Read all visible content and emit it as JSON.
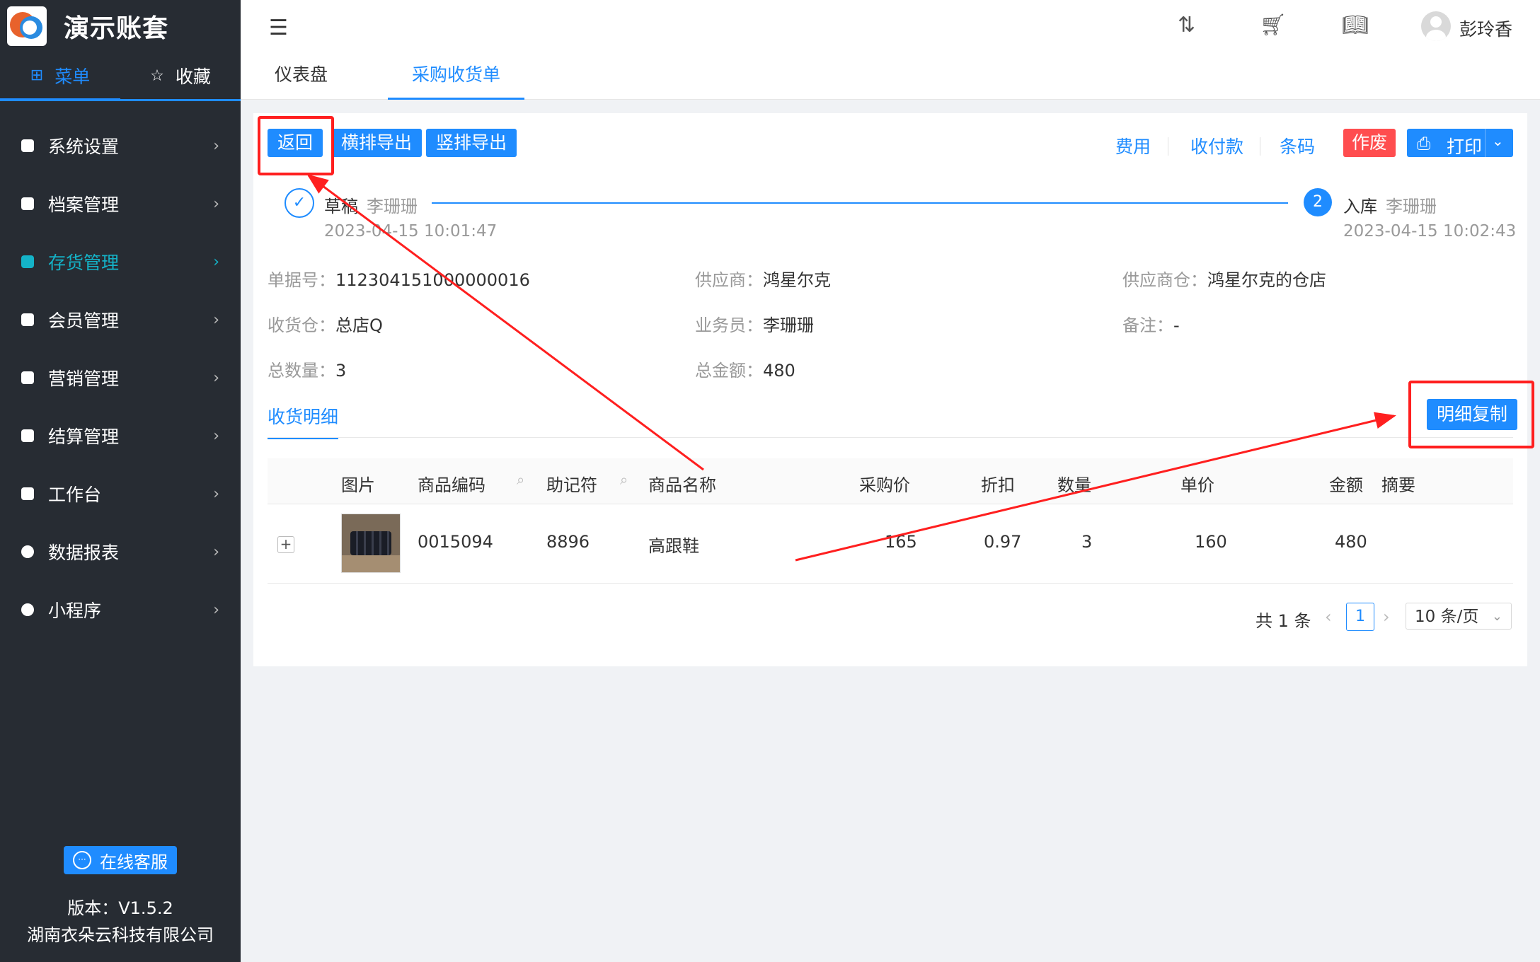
{
  "brand": {
    "title": "演示账套"
  },
  "sidebar": {
    "tabs": [
      {
        "label": "菜单",
        "icon": "grid-icon"
      },
      {
        "label": "收藏",
        "icon": "star-icon"
      }
    ],
    "items": [
      {
        "label": "系统设置"
      },
      {
        "label": "档案管理"
      },
      {
        "label": "存货管理"
      },
      {
        "label": "会员管理"
      },
      {
        "label": "营销管理"
      },
      {
        "label": "结算管理"
      },
      {
        "label": "工作台"
      },
      {
        "label": "数据报表"
      },
      {
        "label": "小程序"
      }
    ],
    "active": "存货管理",
    "online_service": "在线客服",
    "version": "版本：V1.5.2",
    "company": "湖南衣朵云科技有限公司"
  },
  "header": {
    "username": "彭玲香"
  },
  "page_tabs": [
    {
      "label": "仪表盘"
    },
    {
      "label": "采购收货单"
    }
  ],
  "toolbar": {
    "back": "返回",
    "export_h": "横排导出",
    "export_v": "竖排导出",
    "fee": "费用",
    "payment": "收付款",
    "barcode": "条码",
    "void": "作废",
    "print": "打印"
  },
  "steps": [
    {
      "name": "草稿",
      "user": "李珊珊",
      "time": "2023-04-15 10:01:47"
    },
    {
      "num": "2",
      "name": "入库",
      "user": "李珊珊",
      "time": "2023-04-15 10:02:43"
    }
  ],
  "info": {
    "doc_no_k": "单据号：",
    "doc_no_v": "112304151000000016",
    "supplier_k": "供应商：",
    "supplier_v": "鸿星尔克",
    "supplier_wh_k": "供应商仓：",
    "supplier_wh_v": "鸿星尔克的仓店",
    "recv_wh_k": "收货仓：",
    "recv_wh_v": "总店Q",
    "salesman_k": "业务员：",
    "salesman_v": "李珊珊",
    "remark_k": "备注：",
    "remark_v": "-",
    "total_qty_k": "总数量：",
    "total_qty_v": "3",
    "total_amt_k": "总金额：",
    "total_amt_v": "480"
  },
  "detail": {
    "tab": "收货明细",
    "copy_btn": "明细复制",
    "columns": [
      "图片",
      "商品编码",
      "助记符",
      "商品名称",
      "采购价",
      "折扣",
      "数量",
      "单价",
      "金额",
      "摘要"
    ],
    "rows": [
      {
        "code": "0015094",
        "mnemonic": "8896",
        "name": "高跟鞋",
        "price": "165",
        "discount": "0.97",
        "qty": "3",
        "unit_price": "160",
        "amount": "480",
        "memo": ""
      }
    ]
  },
  "pagination": {
    "total": "共 1 条",
    "page": "1",
    "page_size": "10 条/页"
  },
  "annotation_color": "#ff1f1f"
}
